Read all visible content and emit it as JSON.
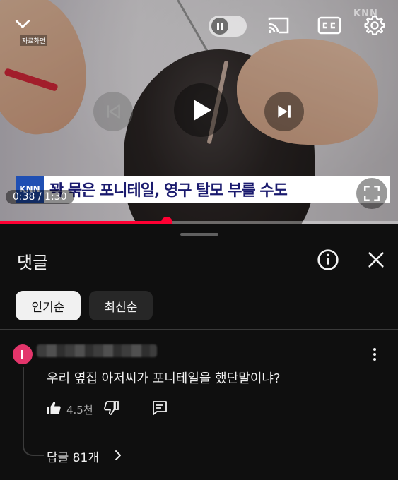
{
  "player": {
    "source_label": "자료화면",
    "watermark": "KNN",
    "caption_logo": "KNN",
    "caption": "꽉 묶은 포니테일, 영구 탈모 부를 수도",
    "time": "0:38 / 1:30",
    "progress": 0.42,
    "accent_color": "#ff0033"
  },
  "panel": {
    "title": "댓글",
    "sort_chips": [
      "인기순",
      "최신순"
    ]
  },
  "comment": {
    "text": "우리 옆집 아저씨가 포니테일을 했단말이냐?",
    "likes": "4.5천",
    "replies": "답글 81개"
  }
}
